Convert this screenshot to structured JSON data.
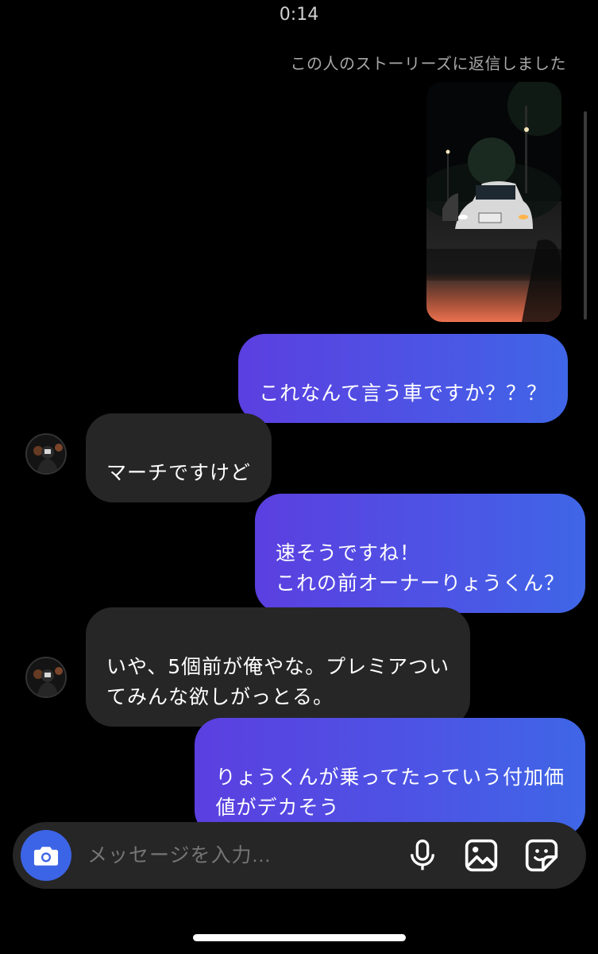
{
  "status_bar": {
    "time": "0:14"
  },
  "story_reply": {
    "note": "この人のストーリーズに返信しました"
  },
  "messages": [
    {
      "from": "me",
      "text": "これなんて言う車ですか？？？"
    },
    {
      "from": "them",
      "text": "マーチですけど"
    },
    {
      "from": "me",
      "text": "速そうですね！\nこれの前オーナーりょうくん？"
    },
    {
      "from": "them",
      "text": "いや、5個前が俺やな。プレミアつい\nてみんな欲しがっとる。"
    },
    {
      "from": "me",
      "text": "りょうくんが乗ってたっていう付加価\n値がデカそう"
    }
  ],
  "composer": {
    "placeholder": "メッセージを入力...",
    "icons": [
      "camera-icon",
      "microphone-icon",
      "gallery-icon",
      "sticker-icon"
    ]
  },
  "colors": {
    "outgoing_start": "#5b3fe0",
    "outgoing_end": "#3f66e6",
    "incoming": "#262626",
    "camera_button": "#3c64e6"
  }
}
